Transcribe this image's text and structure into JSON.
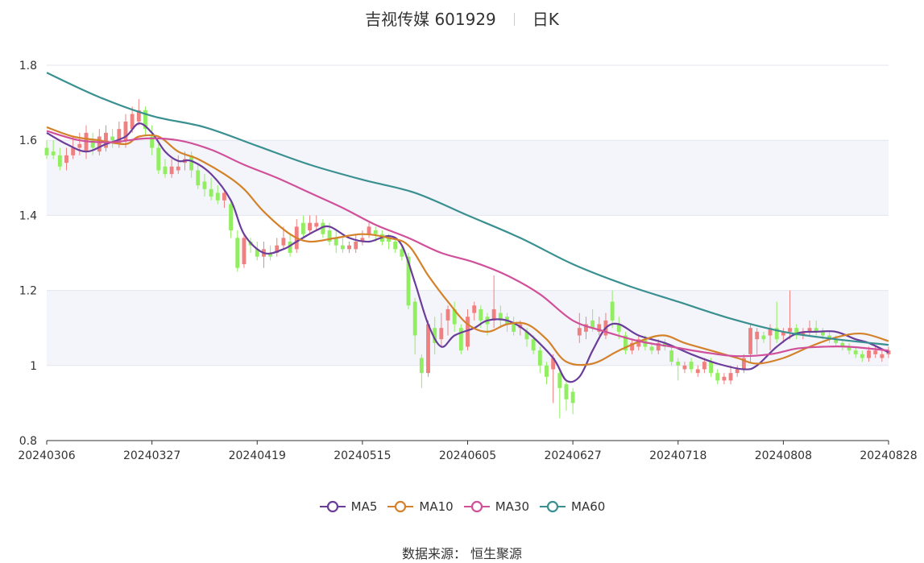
{
  "title": {
    "name": "吉视传媒",
    "code": "601929",
    "period": "日K"
  },
  "source": {
    "label": "数据来源：",
    "value": "恒生聚源"
  },
  "colors": {
    "up": "#f08080",
    "down": "#90ee60",
    "MA5": "#6a3d9a",
    "MA10": "#d4822a",
    "MA30": "#d0509a",
    "MA60": "#3a9090",
    "band": "#f4f5fa",
    "grid": "#e3e6ee",
    "axis": "#333333"
  },
  "chart_data": {
    "type": "candlestick",
    "ylim": [
      0.8,
      1.8
    ],
    "y_ticks": [
      "0.8",
      "1",
      "1.2",
      "1.4",
      "1.6",
      "1.8"
    ],
    "x_ticks": [
      "20240306",
      "20240327",
      "20240419",
      "20240515",
      "20240605",
      "20240627",
      "20240718",
      "20240808",
      "20240828"
    ],
    "x_tick_index": [
      0,
      16,
      32,
      48,
      64,
      80,
      96,
      112,
      128
    ],
    "n_days": 129,
    "candles": [
      [
        1.58,
        1.56,
        1.6,
        1.55
      ],
      [
        1.57,
        1.56,
        1.6,
        1.55
      ],
      [
        1.56,
        1.53,
        1.58,
        1.52
      ],
      [
        1.54,
        1.56,
        1.58,
        1.52
      ],
      [
        1.56,
        1.58,
        1.61,
        1.55
      ],
      [
        1.58,
        1.59,
        1.62,
        1.56
      ],
      [
        1.57,
        1.62,
        1.64,
        1.55
      ],
      [
        1.6,
        1.58,
        1.62,
        1.56
      ],
      [
        1.57,
        1.61,
        1.63,
        1.56
      ],
      [
        1.58,
        1.62,
        1.64,
        1.57
      ],
      [
        1.61,
        1.6,
        1.63,
        1.58
      ],
      [
        1.59,
        1.63,
        1.65,
        1.58
      ],
      [
        1.6,
        1.65,
        1.67,
        1.58
      ],
      [
        1.63,
        1.67,
        1.69,
        1.62
      ],
      [
        1.65,
        1.68,
        1.71,
        1.64
      ],
      [
        1.68,
        1.63,
        1.69,
        1.61
      ],
      [
        1.61,
        1.58,
        1.64,
        1.56
      ],
      [
        1.58,
        1.52,
        1.59,
        1.51
      ],
      [
        1.53,
        1.51,
        1.55,
        1.5
      ],
      [
        1.51,
        1.53,
        1.55,
        1.5
      ],
      [
        1.52,
        1.53,
        1.56,
        1.51
      ],
      [
        1.54,
        1.55,
        1.57,
        1.52
      ],
      [
        1.56,
        1.52,
        1.57,
        1.5
      ],
      [
        1.52,
        1.48,
        1.54,
        1.47
      ],
      [
        1.49,
        1.47,
        1.51,
        1.45
      ],
      [
        1.47,
        1.45,
        1.5,
        1.44
      ],
      [
        1.46,
        1.44,
        1.48,
        1.43
      ],
      [
        1.44,
        1.46,
        1.47,
        1.42
      ],
      [
        1.43,
        1.36,
        1.44,
        1.34
      ],
      [
        1.34,
        1.26,
        1.36,
        1.25
      ],
      [
        1.27,
        1.34,
        1.35,
        1.26
      ],
      [
        1.33,
        1.32,
        1.34,
        1.3
      ],
      [
        1.31,
        1.29,
        1.33,
        1.28
      ],
      [
        1.29,
        1.31,
        1.33,
        1.26
      ],
      [
        1.3,
        1.29,
        1.32,
        1.28
      ],
      [
        1.3,
        1.32,
        1.34,
        1.29
      ],
      [
        1.32,
        1.34,
        1.37,
        1.31
      ],
      [
        1.33,
        1.3,
        1.35,
        1.29
      ],
      [
        1.31,
        1.37,
        1.39,
        1.3
      ],
      [
        1.38,
        1.35,
        1.4,
        1.34
      ],
      [
        1.36,
        1.38,
        1.4,
        1.35
      ],
      [
        1.37,
        1.38,
        1.4,
        1.36
      ],
      [
        1.38,
        1.35,
        1.39,
        1.34
      ],
      [
        1.36,
        1.33,
        1.38,
        1.32
      ],
      [
        1.34,
        1.32,
        1.36,
        1.3
      ],
      [
        1.32,
        1.31,
        1.34,
        1.3
      ],
      [
        1.31,
        1.32,
        1.33,
        1.3
      ],
      [
        1.31,
        1.33,
        1.35,
        1.3
      ],
      [
        1.33,
        1.34,
        1.36,
        1.32
      ],
      [
        1.35,
        1.37,
        1.38,
        1.34
      ],
      [
        1.36,
        1.35,
        1.37,
        1.33
      ],
      [
        1.35,
        1.33,
        1.36,
        1.32
      ],
      [
        1.34,
        1.33,
        1.35,
        1.31
      ],
      [
        1.33,
        1.31,
        1.34,
        1.3
      ],
      [
        1.31,
        1.29,
        1.32,
        1.28
      ],
      [
        1.29,
        1.16,
        1.3,
        1.15
      ],
      [
        1.17,
        1.08,
        1.18,
        1.03
      ],
      [
        1.02,
        0.98,
        1.03,
        0.94
      ],
      [
        0.98,
        1.11,
        1.12,
        0.97
      ],
      [
        1.1,
        1.06,
        1.13,
        1.03
      ],
      [
        1.07,
        1.1,
        1.14,
        1.05
      ],
      [
        1.12,
        1.15,
        1.16,
        1.08
      ],
      [
        1.15,
        1.11,
        1.17,
        1.09
      ],
      [
        1.1,
        1.04,
        1.11,
        1.03
      ],
      [
        1.05,
        1.13,
        1.15,
        1.04
      ],
      [
        1.14,
        1.16,
        1.17,
        1.12
      ],
      [
        1.15,
        1.12,
        1.16,
        1.1
      ],
      [
        1.13,
        1.11,
        1.14,
        1.08
      ],
      [
        1.12,
        1.15,
        1.24,
        1.1
      ],
      [
        1.14,
        1.12,
        1.16,
        1.1
      ],
      [
        1.13,
        1.11,
        1.14,
        1.09
      ],
      [
        1.11,
        1.09,
        1.13,
        1.08
      ],
      [
        1.1,
        1.11,
        1.12,
        1.08
      ],
      [
        1.09,
        1.07,
        1.1,
        1.05
      ],
      [
        1.07,
        1.04,
        1.08,
        1.03
      ],
      [
        1.04,
        1.0,
        1.05,
        0.98
      ],
      [
        1.0,
        0.97,
        1.01,
        0.95
      ],
      [
        0.99,
        1.02,
        1.03,
        0.9
      ],
      [
        0.98,
        0.94,
        0.99,
        0.86
      ],
      [
        0.95,
        0.91,
        0.96,
        0.88
      ],
      [
        0.93,
        0.9,
        0.94,
        0.87
      ],
      [
        1.08,
        1.1,
        1.14,
        1.06
      ],
      [
        1.09,
        1.11,
        1.13,
        1.07
      ],
      [
        1.12,
        1.1,
        1.15,
        1.09
      ],
      [
        1.09,
        1.11,
        1.13,
        1.08
      ],
      [
        1.08,
        1.12,
        1.14,
        1.07
      ],
      [
        1.17,
        1.12,
        1.2,
        1.1
      ],
      [
        1.11,
        1.09,
        1.13,
        1.07
      ],
      [
        1.08,
        1.04,
        1.09,
        1.03
      ],
      [
        1.04,
        1.06,
        1.07,
        1.03
      ],
      [
        1.05,
        1.07,
        1.08,
        1.04
      ],
      [
        1.07,
        1.05,
        1.08,
        1.04
      ],
      [
        1.05,
        1.04,
        1.06,
        1.03
      ],
      [
        1.04,
        1.06,
        1.07,
        1.03
      ],
      [
        1.06,
        1.05,
        1.07,
        1.04
      ],
      [
        1.04,
        1.01,
        1.05,
        1.0
      ],
      [
        1.01,
        1.0,
        1.02,
        0.96
      ],
      [
        0.99,
        1.0,
        1.01,
        0.98
      ],
      [
        1.01,
        0.99,
        1.02,
        0.98
      ],
      [
        0.98,
        0.99,
        1.0,
        0.97
      ],
      [
        0.99,
        1.01,
        1.02,
        0.98
      ],
      [
        1.01,
        0.98,
        1.02,
        0.97
      ],
      [
        0.98,
        0.96,
        0.99,
        0.95
      ],
      [
        0.96,
        0.97,
        0.98,
        0.95
      ],
      [
        0.96,
        0.98,
        1.0,
        0.95
      ],
      [
        0.98,
        0.99,
        1.0,
        0.97
      ],
      [
        0.99,
        1.02,
        1.03,
        0.98
      ],
      [
        1.03,
        1.1,
        1.11,
        1.01
      ],
      [
        1.07,
        1.09,
        1.1,
        1.03
      ],
      [
        1.08,
        1.07,
        1.09,
        1.06
      ],
      [
        1.08,
        1.1,
        1.11,
        1.04
      ],
      [
        1.1,
        1.07,
        1.17,
        1.06
      ],
      [
        1.08,
        1.09,
        1.1,
        1.06
      ],
      [
        1.09,
        1.1,
        1.2,
        1.07
      ],
      [
        1.1,
        1.08,
        1.11,
        1.07
      ],
      [
        1.08,
        1.09,
        1.1,
        1.07
      ],
      [
        1.09,
        1.1,
        1.12,
        1.08
      ],
      [
        1.1,
        1.09,
        1.12,
        1.08
      ],
      [
        1.09,
        1.08,
        1.1,
        1.07
      ],
      [
        1.08,
        1.07,
        1.09,
        1.06
      ],
      [
        1.07,
        1.06,
        1.08,
        1.05
      ],
      [
        1.06,
        1.05,
        1.07,
        1.04
      ],
      [
        1.05,
        1.04,
        1.06,
        1.03
      ],
      [
        1.04,
        1.03,
        1.05,
        1.02
      ],
      [
        1.03,
        1.02,
        1.04,
        1.01
      ],
      [
        1.02,
        1.04,
        1.05,
        1.01
      ],
      [
        1.03,
        1.04,
        1.05,
        1.02
      ],
      [
        1.02,
        1.03,
        1.04,
        1.01
      ],
      [
        1.03,
        1.04,
        1.05,
        1.02
      ]
    ],
    "series": [
      {
        "name": "MA5",
        "anchors": [
          [
            0,
            1.62
          ],
          [
            3,
            1.59
          ],
          [
            6,
            1.57
          ],
          [
            9,
            1.59
          ],
          [
            12,
            1.61
          ],
          [
            14,
            1.645
          ],
          [
            16,
            1.62
          ],
          [
            18,
            1.57
          ],
          [
            20,
            1.545
          ],
          [
            22,
            1.545
          ],
          [
            25,
            1.51
          ],
          [
            28,
            1.44
          ],
          [
            30,
            1.35
          ],
          [
            33,
            1.3
          ],
          [
            36,
            1.31
          ],
          [
            38,
            1.33
          ],
          [
            41,
            1.36
          ],
          [
            43,
            1.37
          ],
          [
            46,
            1.34
          ],
          [
            49,
            1.33
          ],
          [
            52,
            1.345
          ],
          [
            54,
            1.32
          ],
          [
            56,
            1.22
          ],
          [
            58,
            1.11
          ],
          [
            60,
            1.05
          ],
          [
            62,
            1.08
          ],
          [
            65,
            1.1
          ],
          [
            67,
            1.12
          ],
          [
            70,
            1.12
          ],
          [
            73,
            1.09
          ],
          [
            77,
            1.02
          ],
          [
            79,
            0.96
          ],
          [
            81,
            0.97
          ],
          [
            83,
            1.04
          ],
          [
            85,
            1.1
          ],
          [
            87,
            1.11
          ],
          [
            90,
            1.08
          ],
          [
            94,
            1.06
          ],
          [
            98,
            1.03
          ],
          [
            102,
            1.005
          ],
          [
            106,
            0.99
          ],
          [
            108,
            1.0
          ],
          [
            111,
            1.05
          ],
          [
            114,
            1.085
          ],
          [
            117,
            1.09
          ],
          [
            120,
            1.09
          ],
          [
            123,
            1.07
          ],
          [
            125,
            1.06
          ],
          [
            128,
            1.035
          ]
        ]
      },
      {
        "name": "MA10",
        "anchors": [
          [
            0,
            1.635
          ],
          [
            4,
            1.61
          ],
          [
            8,
            1.6
          ],
          [
            12,
            1.59
          ],
          [
            14,
            1.61
          ],
          [
            17,
            1.61
          ],
          [
            20,
            1.57
          ],
          [
            23,
            1.55
          ],
          [
            27,
            1.51
          ],
          [
            30,
            1.47
          ],
          [
            33,
            1.41
          ],
          [
            37,
            1.35
          ],
          [
            40,
            1.33
          ],
          [
            44,
            1.34
          ],
          [
            48,
            1.35
          ],
          [
            52,
            1.34
          ],
          [
            55,
            1.32
          ],
          [
            58,
            1.24
          ],
          [
            61,
            1.17
          ],
          [
            64,
            1.11
          ],
          [
            67,
            1.09
          ],
          [
            70,
            1.11
          ],
          [
            73,
            1.11
          ],
          [
            76,
            1.07
          ],
          [
            79,
            1.01
          ],
          [
            83,
            1.005
          ],
          [
            87,
            1.04
          ],
          [
            91,
            1.07
          ],
          [
            94,
            1.08
          ],
          [
            97,
            1.06
          ],
          [
            101,
            1.04
          ],
          [
            105,
            1.02
          ],
          [
            108,
            1.005
          ],
          [
            112,
            1.02
          ],
          [
            116,
            1.05
          ],
          [
            120,
            1.075
          ],
          [
            124,
            1.085
          ],
          [
            128,
            1.065
          ]
        ]
      },
      {
        "name": "MA30",
        "anchors": [
          [
            0,
            1.625
          ],
          [
            5,
            1.6
          ],
          [
            10,
            1.595
          ],
          [
            15,
            1.605
          ],
          [
            20,
            1.6
          ],
          [
            25,
            1.575
          ],
          [
            30,
            1.535
          ],
          [
            35,
            1.5
          ],
          [
            40,
            1.46
          ],
          [
            45,
            1.42
          ],
          [
            50,
            1.375
          ],
          [
            55,
            1.34
          ],
          [
            60,
            1.3
          ],
          [
            65,
            1.275
          ],
          [
            70,
            1.24
          ],
          [
            75,
            1.19
          ],
          [
            80,
            1.12
          ],
          [
            85,
            1.09
          ],
          [
            90,
            1.065
          ],
          [
            95,
            1.05
          ],
          [
            100,
            1.035
          ],
          [
            105,
            1.025
          ],
          [
            110,
            1.03
          ],
          [
            114,
            1.045
          ],
          [
            118,
            1.05
          ],
          [
            122,
            1.05
          ],
          [
            128,
            1.04
          ]
        ]
      },
      {
        "name": "MA60",
        "anchors": [
          [
            0,
            1.78
          ],
          [
            8,
            1.715
          ],
          [
            16,
            1.665
          ],
          [
            24,
            1.635
          ],
          [
            32,
            1.585
          ],
          [
            40,
            1.535
          ],
          [
            48,
            1.495
          ],
          [
            56,
            1.46
          ],
          [
            64,
            1.4
          ],
          [
            72,
            1.34
          ],
          [
            80,
            1.27
          ],
          [
            88,
            1.215
          ],
          [
            96,
            1.17
          ],
          [
            104,
            1.125
          ],
          [
            112,
            1.09
          ],
          [
            120,
            1.07
          ],
          [
            128,
            1.055
          ]
        ]
      }
    ]
  }
}
